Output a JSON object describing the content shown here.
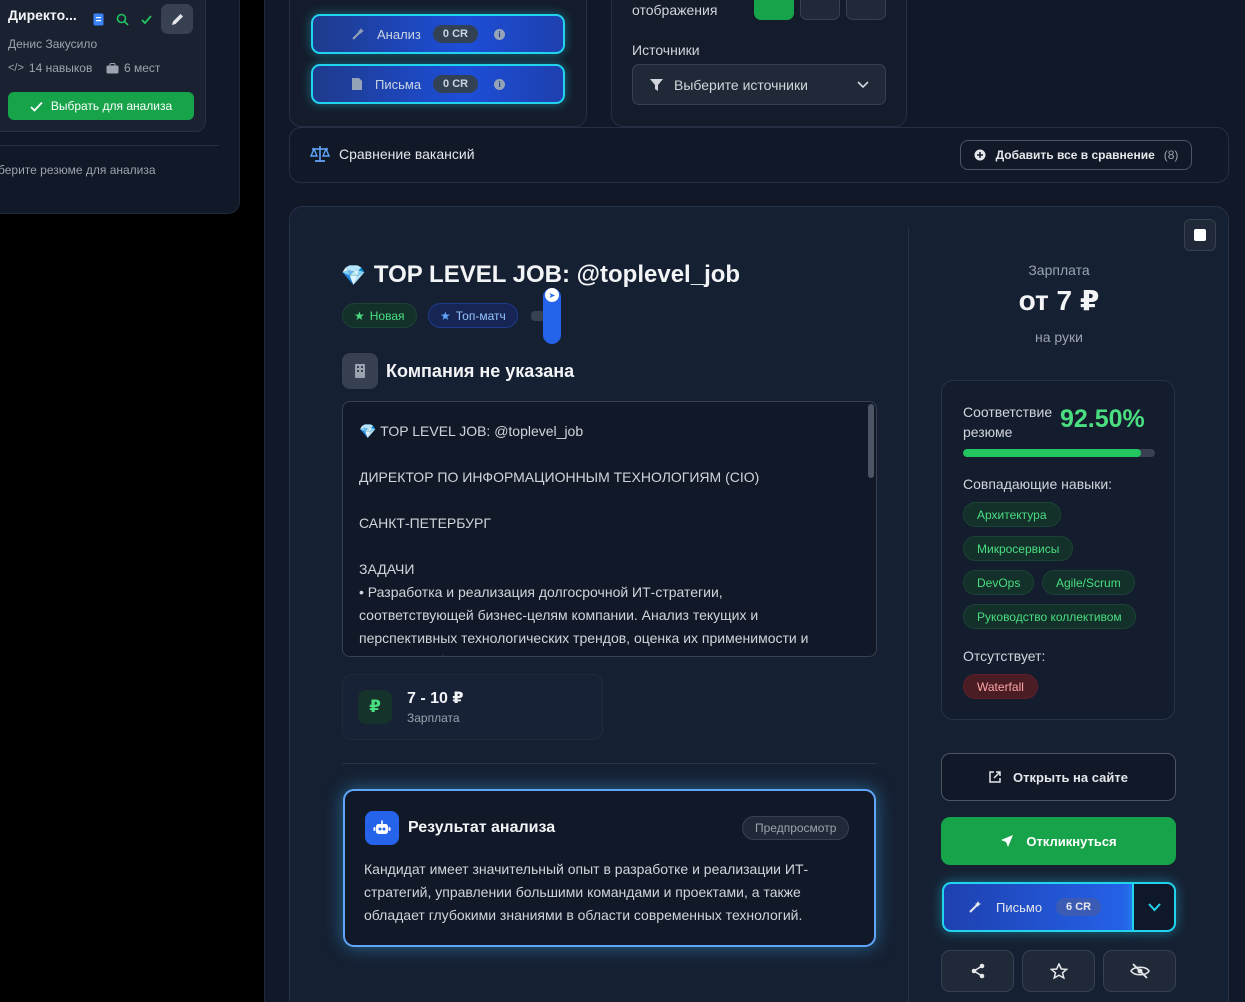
{
  "left_panel": {
    "resume_title": "Директо...",
    "author": "Денис Закусило",
    "skills_count": "14 навыков",
    "jobs_count": "6 мест",
    "select_label": "Выбрать для анализа",
    "hint": "берите резюме для анализа"
  },
  "tools": {
    "analysis_label": "Анализ",
    "analysis_cr": "0 CR",
    "letters_label": "Письма",
    "letters_cr": "0 CR"
  },
  "display": {
    "label": "отображения",
    "sources_label": "Источники",
    "sources_placeholder": "Выберите источники"
  },
  "compare": {
    "title": "Сравнение вакансий",
    "add_all_label": "Добавить все в сравнение",
    "count": "(8)"
  },
  "job": {
    "emoji": "💎",
    "title": "TOP LEVEL JOB: @toplevel_job",
    "tag_new": "Новая",
    "tag_top": "Топ-матч",
    "company": "Компания не указана",
    "description": "💎 TOP LEVEL JOB: @toplevel_job\n\nДИРЕКТОР ПО ИНФОРМАЦИОННЫМ ТЕХНОЛОГИЯМ (CIO)\n\nСАНКТ-ПЕТЕРБУРГ\n\nЗАДАЧИ\n• Разработка и реализация долгосрочной ИТ-стратегии, соответствующей бизнес-целям компании. Анализ текущих и перспективных технологических трендов, оценка их применимости и влияния на бизнес;",
    "salary_range": "7 - 10 ₽",
    "salary_caption": "Зарплата",
    "ruble_symbol": "₽"
  },
  "result": {
    "title": "Результат анализа",
    "badge": "Предпросмотр",
    "text": "Кандидат имеет значительный опыт в разработке и реализации ИТ-стратегий, управлении большими командами и проектами, а также обладает глубокими знаниями в области современных технологий."
  },
  "salary": {
    "label": "Зарплата",
    "value": "от 7 ₽",
    "note": "на руки"
  },
  "match": {
    "label": "Соответствие резюме",
    "percent": "92.50%",
    "percent_value": 92.5,
    "skills_label": "Совпадающие навыки:",
    "skills": [
      "Архитектура",
      "Микросервисы",
      "DevOps",
      "Agile/Scrum",
      "Руководство коллективом"
    ],
    "missing_label": "Отсутствует:",
    "missing": [
      "Waterfall"
    ]
  },
  "actions": {
    "open_site": "Открыть на сайте",
    "apply": "Откликнуться",
    "letter": "Письмо",
    "letter_cr": "6 CR"
  }
}
